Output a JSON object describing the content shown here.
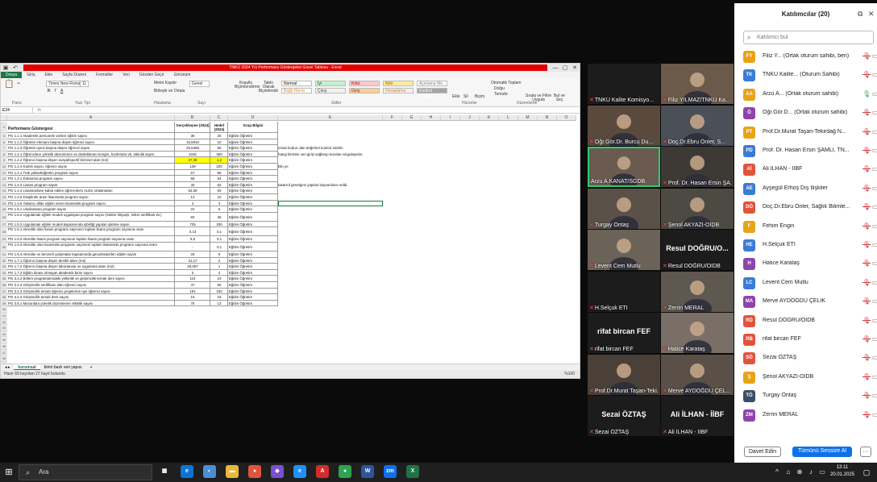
{
  "excel": {
    "title_bar": "TNKÜ 2024 Yılı Performans Göstergeleri Excel Tablosu - Excel",
    "window_controls": [
      "—",
      "▢",
      "✕"
    ],
    "tabs": [
      "Dosya",
      "Giriş",
      "Ekle",
      "Sayfa Düzeni",
      "Formüller",
      "Veri",
      "Gözden Geçir",
      "Görünüm"
    ],
    "ribbon": {
      "font_name": "Times New Roman",
      "font_size": "11",
      "wrap_text": "Metni Kaydır",
      "merge": "Birleştir ve Ortala",
      "number_format": "Genel",
      "cond_format": "Koşullu Biçimlendirme",
      "table_format": "Tablo Olarak Biçimlendir",
      "styles": [
        "Normal",
        "İyi",
        "Kötü",
        "Nötr",
        "Açıklama Me...",
        "Bağlı Hücre",
        "Çıkış",
        "Giriş",
        "Hesaplama",
        "Kontrol Hücresi"
      ],
      "insert": "Ekle",
      "delete": "Sil",
      "format": "Biçim",
      "autosum": "Otomatik Toplam",
      "fill": "Dolgu",
      "clear": "Temizle",
      "sort": "Sırala ve Filtre Uygula",
      "find": "Bul ve Seç",
      "groups": [
        "Pano",
        "Yazı Tipi",
        "Hizalama",
        "Sayı",
        "Stiller",
        "Hücreler",
        "Düzenleme"
      ]
    },
    "name_box": "E24",
    "columns": [
      "A",
      "B",
      "C",
      "D",
      "E",
      "F",
      "G",
      "H",
      "I",
      "J",
      "K",
      "L",
      "M",
      "N",
      "O"
    ],
    "header_row": {
      "rn": "4",
      "a": "Performans Göstergesi",
      "b": "Gerçekleşme (2024)",
      "c": "Hedef (2024)",
      "d": "Grup Bilgisi"
    },
    "rows": [
      {
        "rn": "5",
        "a": "PG 1.1.1 Akademik personele verilen eğitim sayısı",
        "b": "36",
        "c": "25",
        "d": "Eğitim Öğretim",
        "e": ""
      },
      {
        "rn": "6",
        "a": "PG 1.1.2 Öğretim elemanı başına düşen öğrenci sayısı",
        "b": "15,6916",
        "c": "10",
        "d": "Eğitim Öğretim",
        "e": ""
      },
      {
        "rn": "7",
        "a": "PG 1.1.3 Öğretim üyesi başına düşen öğrenci sayısı",
        "b": "25,5458",
        "c": "65",
        "d": "Eğitim Öğretim",
        "e": "nrsan kodun olan değerleri kontrol edelim"
      },
      {
        "rn": "8",
        "a": "PG 1.2.1 Öğrencilere yönelik düzenlenen ve desteklenen kongre, konferans vb. etkinlik sayısı",
        "b": "1045",
        "c": "300",
        "d": "Eğitim Öğretim",
        "e": "hangi birimler veri girişi sağlanıp kurulan sorgulayalım."
      },
      {
        "rn": "9",
        "a": "PG 1.2.2 Öğrenci başına düşen sosyal/sportif birimsel alan (m2)",
        "b": "27,36",
        "c": "1,2",
        "d": "Eğitim Öğretim",
        "e": "",
        "hl": true
      },
      {
        "rn": "10",
        "a": "PG 1.2.4 Kantin sayısı, öğrenci sayısı",
        "b": "139",
        "c": "220",
        "d": "Eğitim Öğretim",
        "e": "bilo ye"
      },
      {
        "rn": "11",
        "a": "PG 1.4.1 Türk yükseköğretim program sayısı",
        "b": "67",
        "c": "58",
        "d": "Eğitim Öğretim",
        "e": ""
      },
      {
        "rn": "12",
        "a": "PG 1.3.1 Doldurma program sayısı",
        "b": "56",
        "c": "54",
        "d": "Eğitim Öğretim",
        "e": ""
      },
      {
        "rn": "13",
        "a": "PG 1.4.3 Lisans program sayısı",
        "b": "40",
        "c": "62",
        "d": "Eğitim Öğretim",
        "e": "tasarruf genelgesi yapılan başvurulanı reddi."
      },
      {
        "rn": "14",
        "a": "PG 1.4.4 Lisansüstüne kabul edilen öğrencilerin ALES ortalamaları",
        "b": "64,08",
        "c": "60",
        "d": "Eğitim Öğretim",
        "e": ""
      },
      {
        "rn": "15",
        "a": "PG 1.4.5 Disiplinler arası lisansüstü program sayısı",
        "b": "12",
        "c": "15",
        "d": "Eğitim Öğretim",
        "e": ""
      },
      {
        "rn": "24",
        "a": "PG 1.4.6 Yabancı dilde eğitim veren lisansüstü program sayısı",
        "b": "4",
        "c": "3",
        "d": "Eğitim Öğretim",
        "e": ""
      },
      {
        "rn": "25",
        "a": "PG 1.5.1 Uluslararası program sayısı",
        "b": "22",
        "c": "6",
        "d": "Eğitim Öğretim",
        "e": ""
      },
      {
        "rn": "26",
        "a": "PG 1.5.2 Uygulamalı eğitim modeli uygulayan program sayısı (Sektör ihtiyaçlı, mikro sertifikalı vb.)",
        "b": "83",
        "c": "35",
        "d": "Eğitim Öğretim",
        "e": "",
        "tall": true
      },
      {
        "rn": "27",
        "a": "PG 1.5.3 Uygulamalı eğitim modeli kapsamında işbirliği yapılan işletme sayısı",
        "b": "725",
        "c": "200",
        "d": "Eğitim Öğretim",
        "e": ""
      },
      {
        "rn": "28",
        "a": "PG 1.6.1 Akredite olan lisans programı sayısının toplam lisans programı sayısına oranı",
        "b": "0,13",
        "c": "0,1",
        "d": "Eğitim Öğretim",
        "e": "",
        "tall": true
      },
      {
        "rn": "29",
        "a": "PG 1.6.2 Akredite lisans program sayısının toplam lisans program sayısına oranı",
        "b": "5,5",
        "c": "0,1",
        "d": "Eğitim Öğretim",
        "e": ""
      },
      {
        "rn": "30",
        "a": "PG 1.6.3 Akredite olan lisansüstü programı sayısının toplam lisansüstü programı sayısına oranı",
        "b": "-",
        "c": "0,1",
        "d": "Eğitim Öğretim",
        "e": "",
        "tall": true
      },
      {
        "rn": "31",
        "a": "PG 1.6.4 Akredite ve benzerli çalışmalar kapsamında gerçekleştirilen eğitim sayısı",
        "b": "25",
        "c": "9",
        "d": "Eğitim Öğretim",
        "e": ""
      },
      {
        "rn": "32",
        "a": "PG 1.7.1 Öğrenci başına düşen derslik alanı (m2)",
        "b": "31,17",
        "c": "2",
        "d": "Eğitim Öğretim",
        "e": ""
      },
      {
        "rn": "33",
        "a": "PG 1.7.2 Öğrenci başına düşen laboratuvar ve uygulama alanı (m2)",
        "b": "29,067",
        "c": "1",
        "d": "Eğitim Öğretim",
        "e": ""
      },
      {
        "rn": "34",
        "a": "PG 1.7.3 Eğitim binası olmayan akademik birim sayısı",
        "b": "3",
        "c": "4",
        "d": "Eğitim Öğretim",
        "e": ""
      },
      {
        "rn": "35",
        "a": "PG 3.4.2 Bölüm programlarındaki yetkinlik ve girişimcilik temalı ders sayısı",
        "b": "114",
        "c": "10",
        "d": "Eğitim Öğretim",
        "e": ""
      },
      {
        "rn": "36",
        "a": "PG 3.4.2 Girişimcilik sertifikası alan öğrenci sayısı",
        "b": "47",
        "c": "55",
        "d": "Eğitim Öğretim",
        "e": ""
      },
      {
        "rn": "37",
        "a": "PG 3.4.3 Girişimcilik temalı öğrenci projelerine üye öğrenci sayısı",
        "b": "191",
        "c": "100",
        "d": "Eğitim Öğretim",
        "e": ""
      },
      {
        "rn": "38",
        "a": "PG 3.4.4 Girişimcilik temalı ders sayısı",
        "b": "15",
        "c": "15",
        "d": "Eğitim Öğretim",
        "e": ""
      },
      {
        "rn": "39",
        "a": "PG 3.5.1 Mezunlara yönelik düzenlenen etkinlik sayısı",
        "b": "78",
        "c": "13",
        "d": "Eğitim Öğretim",
        "e": ""
      }
    ],
    "empty_rows": [
      "40",
      "41",
      "42",
      "43",
      "44",
      "45",
      "46",
      "47",
      "48",
      "49"
    ],
    "sheet_tabs": [
      "kurumsal",
      "birim bazlı veri yapısı",
      "+"
    ],
    "status": "Hazır   69 kayıttan 27 kayıt bulundu",
    "zoom": "%100"
  },
  "videos": [
    {
      "name": "TNKÜ Kalite Komisyo...",
      "muted": true,
      "type": "dark",
      "big": ""
    },
    {
      "name": "Filiz YILMAZ/TNKÜ Ka...",
      "muted": true,
      "type": "photo",
      "big": ""
    },
    {
      "name": "Öğr.Gör.Dr. Burcu Du...",
      "muted": true,
      "type": "photo",
      "big": ""
    },
    {
      "name": "Doç.Dr.Ebru Önler, S...",
      "muted": true,
      "type": "photo",
      "big": ""
    },
    {
      "name": "Arzu A.KANAT/SGDB",
      "muted": false,
      "type": "photo",
      "big": "",
      "active": true
    },
    {
      "name": "Prof. Dr. Hasan Ersin ŞA...",
      "muted": true,
      "type": "photo",
      "big": ""
    },
    {
      "name": "Turgay Öntaş",
      "muted": true,
      "type": "photo",
      "big": ""
    },
    {
      "name": "Şenol AKYAZI-OİDB",
      "muted": true,
      "type": "photo",
      "big": ""
    },
    {
      "name": "Levent Cem Mutlu",
      "muted": true,
      "type": "photo",
      "big": ""
    },
    {
      "name": "Resul DOĞRU/OİDB",
      "muted": true,
      "type": "dark",
      "big": "Resul DOĞRU/O..."
    },
    {
      "name": "H.Selçuk ETİ",
      "muted": true,
      "type": "dark",
      "big": ""
    },
    {
      "name": "Zerrin MERAL",
      "muted": true,
      "type": "photo",
      "big": ""
    },
    {
      "name": "rifat bircan FEF",
      "muted": true,
      "type": "dark",
      "big": "rifat bircan FEF"
    },
    {
      "name": "Hatice Karataş",
      "muted": true,
      "type": "photo",
      "big": ""
    },
    {
      "name": "Prof.Dr.Murat Taşan-Teki...",
      "muted": true,
      "type": "photo",
      "big": ""
    },
    {
      "name": "Merve AYDOĞDU ÇEL...",
      "muted": true,
      "type": "photo",
      "big": ""
    },
    {
      "name": "Sezai ÖZTAŞ",
      "muted": true,
      "type": "dark",
      "big": "Sezai ÖZTAŞ"
    },
    {
      "name": "Ali İLHAN - İİBF",
      "muted": true,
      "type": "dark",
      "big": "Ali İLHAN - İİBF"
    }
  ],
  "panel": {
    "title": "Katılımcılar (20)",
    "search_placeholder": "Katılımcı bul",
    "popout_icon": "⧉",
    "close_icon": "✕",
    "participants": [
      {
        "initials": "FY",
        "name": "Filiz Y... (Ortak oturum sahibi, ben)",
        "color": "#e8a317",
        "muted": true
      },
      {
        "initials": "TK",
        "name": "TNKÜ Kalite... (Oturum Sahibi)",
        "color": "#3a7bd5",
        "muted": true
      },
      {
        "initials": "AA",
        "name": "Arzu A... (Ortak oturum sahibi)",
        "color": "#e8a317",
        "muted": false
      },
      {
        "initials": "Ö",
        "name": "Öğr.Gör.D... (Ortak oturum sahibi)",
        "color": "#8e44ad",
        "muted": true
      },
      {
        "initials": "PT",
        "name": "Prof.Dr.Murat Taşan-Tekirdağ N...",
        "color": "#e8a317",
        "muted": true
      },
      {
        "initials": "PD",
        "name": "Prof. Dr. Hasan Ersin ŞAMLI, TN...",
        "color": "#3a7bd5",
        "muted": true
      },
      {
        "initials": "Aİ",
        "name": "Ali İLHAN - İİBF",
        "color": "#e0533d",
        "muted": true
      },
      {
        "initials": "AE",
        "name": "Ayşegül Erhoş Dış İlişkiler",
        "color": "#3a7bd5",
        "muted": true
      },
      {
        "initials": "DÖ",
        "name": "Doç.Dr.Ebru Önler, Sağlık Bilimle...",
        "color": "#e0533d",
        "muted": true
      },
      {
        "initials": "F",
        "name": "Fehim Engin",
        "color": "#e8a317",
        "muted": true
      },
      {
        "initials": "HE",
        "name": "H.Selçuk ETİ",
        "color": "#3a7bd5",
        "muted": true
      },
      {
        "initials": "H",
        "name": "Hatice Karataş",
        "color": "#8e44ad",
        "muted": true
      },
      {
        "initials": "LC",
        "name": "Levent Cem Mutlu",
        "color": "#3a7bd5",
        "muted": true
      },
      {
        "initials": "MA",
        "name": "Merve AYDOĞDU ÇELİK",
        "color": "#8e44ad",
        "muted": true
      },
      {
        "initials": "RD",
        "name": "Resul DOĞRU/OİDB",
        "color": "#e0533d",
        "muted": true
      },
      {
        "initials": "RB",
        "name": "rifat bircan FEF",
        "color": "#e0533d",
        "muted": true
      },
      {
        "initials": "SÖ",
        "name": "Sezai ÖZTAŞ",
        "color": "#e0533d",
        "muted": true
      },
      {
        "initials": "Ş",
        "name": "Şenol AKYAZI-OİDB",
        "color": "#e8a317",
        "muted": true
      },
      {
        "initials": "TÖ",
        "name": "Turgay Öntaş",
        "color": "#3a4f66",
        "muted": true
      },
      {
        "initials": "ZM",
        "name": "Zerrin MERAL",
        "color": "#8e44ad",
        "muted": true
      }
    ],
    "invite_label": "Davet Edin",
    "mute_all_label": "Tümünü Sessize Al",
    "more_label": "···"
  },
  "taskbar": {
    "search_placeholder": "Ara",
    "time": "13:11",
    "date": "20.01.2025",
    "apps": [
      {
        "label": "▦",
        "color": "#1f1f1f"
      },
      {
        "label": "e",
        "color": "#0a74d8"
      },
      {
        "label": "◐",
        "color": "#4a8fd6"
      },
      {
        "label": "▬",
        "color": "#e8b83a"
      },
      {
        "label": "●",
        "color": "#e0533d"
      },
      {
        "label": "◆",
        "color": "#7a4fd0"
      },
      {
        "label": "e",
        "color": "#1e90ff"
      },
      {
        "label": "A",
        "color": "#d62b2b"
      },
      {
        "label": "●",
        "color": "#2ea44f"
      },
      {
        "label": "W",
        "color": "#2b579a"
      },
      {
        "label": "zm",
        "color": "#0e71eb"
      },
      {
        "label": "X",
        "color": "#217346"
      }
    ]
  }
}
